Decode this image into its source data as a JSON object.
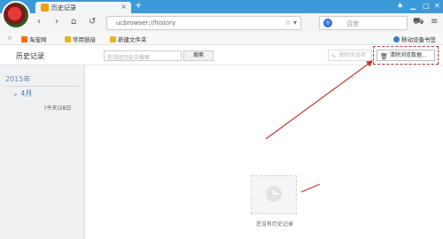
{
  "tab": {
    "title": "历史记录",
    "close": "×"
  },
  "nav": {
    "url": "ucbrowser://history",
    "search_engine_icon": "360-search-icon",
    "search_placeholder": "百度",
    "new_tab": "+"
  },
  "bookmarks": {
    "items": [
      "淘宝网",
      "常用链接",
      "新建文件夹"
    ],
    "mobile": "移动设备书签"
  },
  "page": {
    "title": "历史记录",
    "search_placeholder": "在浏览历史中搜索",
    "search_button": "搜索",
    "delete_selected": "删除所选项",
    "clear_data": "清除浏览数据..."
  },
  "sidebar": {
    "year": "2015年",
    "month": "4月",
    "day": "(今天)28日"
  },
  "empty": {
    "text": "还没有历史记录"
  },
  "colors": {
    "titlebar": "#3c9ad8",
    "accent": "#3c7cc4",
    "arrow": "#c0392b"
  }
}
